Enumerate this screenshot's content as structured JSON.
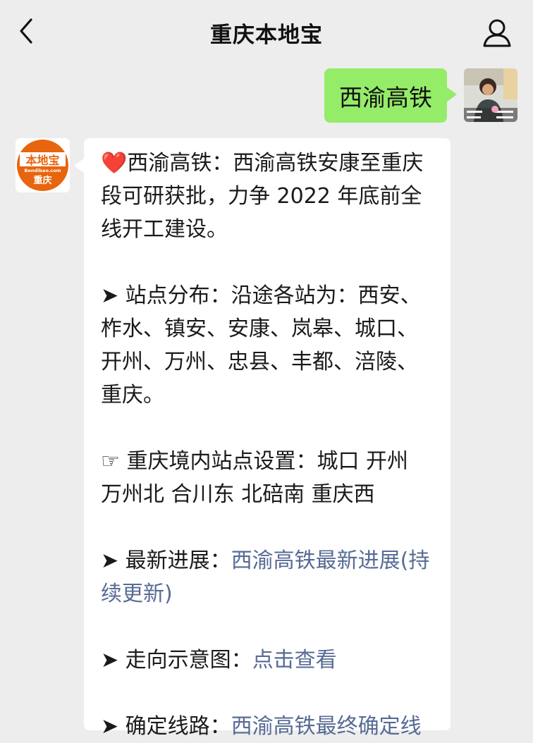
{
  "header": {
    "title": "重庆本地宝"
  },
  "outgoing": {
    "text": "西渝高铁"
  },
  "bot_logo": {
    "brand": "本地宝",
    "url_text": "Bendibao.com",
    "city": "重庆"
  },
  "incoming": {
    "p1": {
      "icon": "❤️",
      "text": "西渝高铁：西渝高铁安康至重庆段可研获批，力争 2022 年底前全线开工建设。"
    },
    "p2": {
      "icon": "➤",
      "text": " 站点分布：沿途各站为：西安、柞水、镇安、安康、岚皋、城口、开州、万州、忠县、丰都、涪陵、重庆。"
    },
    "p3": {
      "icon": "☞",
      "text": " 重庆境内站点设置：城口 开州 万州北 合川东 北碚南 重庆西"
    },
    "p4": {
      "icon": "➤",
      "label": " 最新进展：",
      "link": "西渝高铁最新进展(持续更新)"
    },
    "p5": {
      "icon": "➤",
      "label": " 走向示意图：",
      "link": "点击查看"
    },
    "p6": {
      "icon": "➤",
      "label": " 确定线路：",
      "link": "西渝高铁最终确定线"
    }
  },
  "colors": {
    "background": "#ededed",
    "outgoing_bubble": "#95ec69",
    "link": "#576b95",
    "logo_orange": "#e8650f"
  },
  "icons": {
    "back": "chevron-left-icon",
    "profile": "user-icon"
  }
}
